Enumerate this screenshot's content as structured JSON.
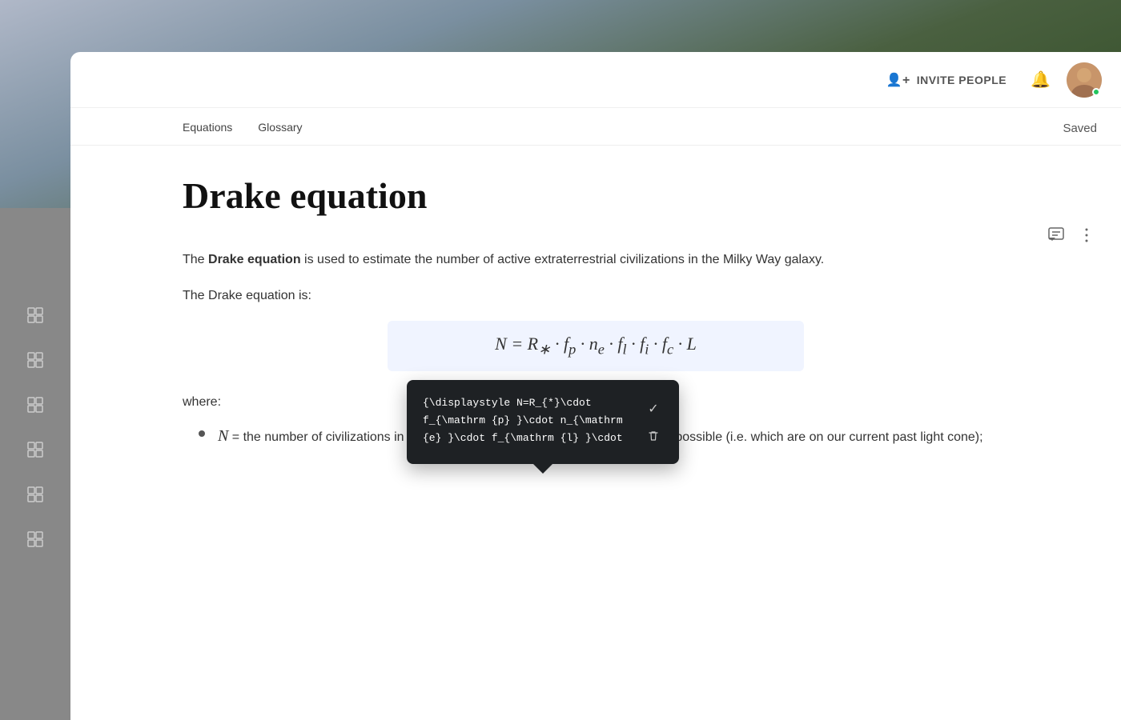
{
  "background": {
    "gradient": "mountain landscape"
  },
  "header": {
    "invite_label": "INVITE PEOPLE",
    "saved_label": "Saved"
  },
  "sidebar": {
    "collapse_icon": "«",
    "icons": [
      "□",
      "□",
      "□",
      "□",
      "□",
      "□"
    ]
  },
  "tabs": [
    {
      "label": "Equations"
    },
    {
      "label": "Glossary"
    }
  ],
  "content": {
    "title": "Drake equation",
    "para1_pre": "The ",
    "para1_bold": "Drake equation",
    "para1_post": " is used to estimate the number of active extraterrestrial civilizations in the Milky Way galaxy.",
    "para2": "The Drake equation is:",
    "equation_latex_line1": "{\\displaystyle N=R_{*}\\cdot",
    "equation_latex_line2": "f_{\\mathrm {p} }\\cdot n_{\\mathrm",
    "equation_latex_line3": "{e} }\\cdot f_{\\mathrm {l} }\\cdot",
    "equation_display": "N = R∗ · fp · ne · fl · fi · fc · L",
    "where_label": "where:",
    "bullet1_var": "N",
    "bullet1_text": " = the number of civilizations in our galaxy with which communication might be possible (i.e. which are on our current past light cone);"
  },
  "popup": {
    "code_line1": "{\\displaystyle N=R_{*}\\cdot",
    "code_line2": "f_{\\mathrm {p} }\\cdot n_{\\mathrm",
    "code_line3": "{e} }\\cdot f_{\\mathrm {l} }\\cdot",
    "check_icon": "✓",
    "delete_icon": "🗑"
  }
}
